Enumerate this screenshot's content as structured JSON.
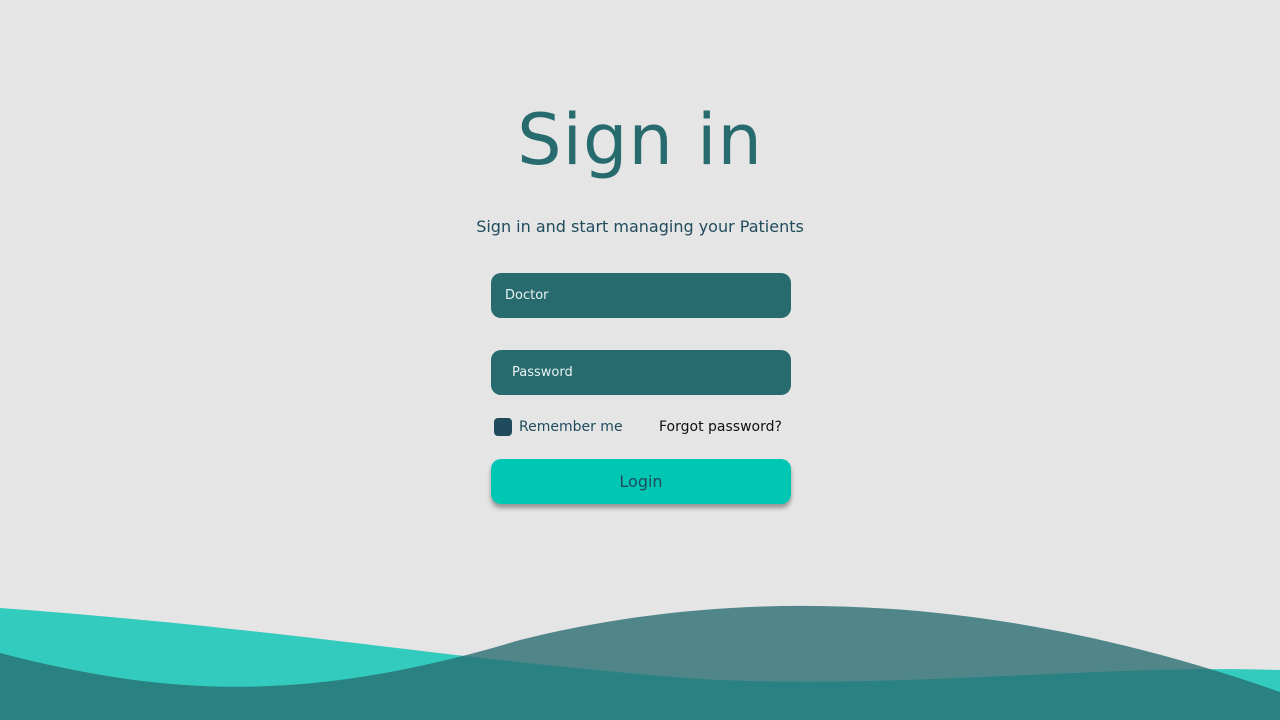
{
  "heading": "Sign in",
  "subheading": "Sign in and start managing your Patients",
  "form": {
    "username_placeholder": "Doctor",
    "password_placeholder": "Password",
    "remember_label": "Remember me",
    "remember_checked": false,
    "forgot_label": "Forgot password?",
    "login_label": "Login"
  },
  "colors": {
    "background": "#e5e5e5",
    "primary": "#276b6f",
    "accent": "#00c6b4",
    "text_dark": "#1f4b5c"
  }
}
